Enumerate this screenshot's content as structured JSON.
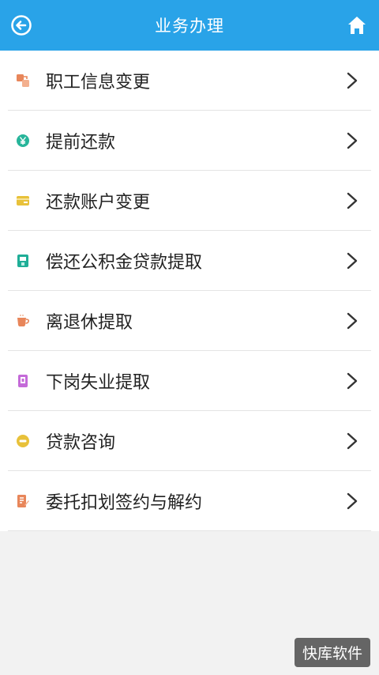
{
  "header": {
    "title": "业务办理",
    "back_icon": "back-arrow-circle-icon",
    "home_icon": "home-icon",
    "color": "#29a3e8"
  },
  "menu": {
    "items": [
      {
        "label": "职工信息变更",
        "icon": "transfer-icon",
        "icon_color": "#e8865a"
      },
      {
        "label": "提前还款",
        "icon": "yen-coin-icon",
        "icon_color": "#27b59a"
      },
      {
        "label": "还款账户变更",
        "icon": "card-icon",
        "icon_color": "#e8c13a"
      },
      {
        "label": "偿还公积金贷款提取",
        "icon": "atm-icon",
        "icon_color": "#1fae97"
      },
      {
        "label": "离退休提取",
        "icon": "cup-icon",
        "icon_color": "#e8865a"
      },
      {
        "label": "下岗失业提取",
        "icon": "id-card-icon",
        "icon_color": "#c46ad8"
      },
      {
        "label": "贷款咨询",
        "icon": "chat-icon",
        "icon_color": "#e8c13a"
      },
      {
        "label": "委托扣划签约与解约",
        "icon": "document-sign-icon",
        "icon_color": "#e8865a"
      }
    ]
  },
  "watermark": "快库软件"
}
